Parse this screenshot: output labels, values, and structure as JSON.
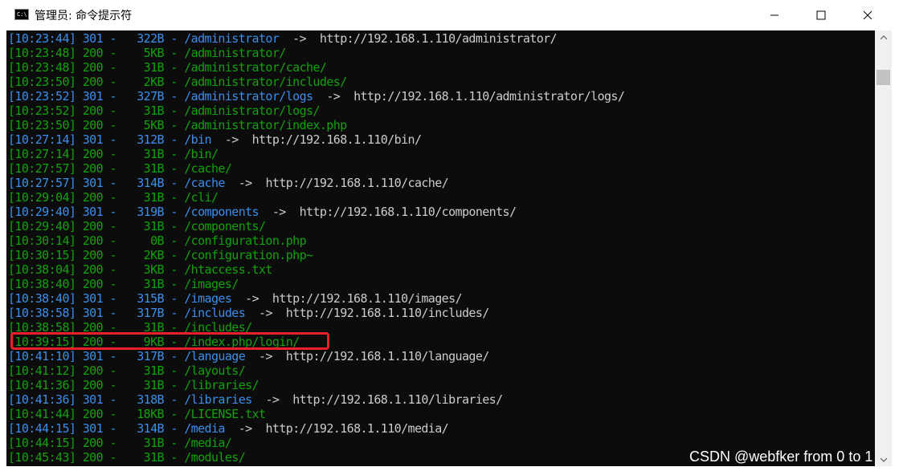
{
  "window": {
    "title": "管理员: 命令提示符",
    "icon_text": "C:\\"
  },
  "console": {
    "lines": [
      {
        "time": "[10:23:44]",
        "status": "301",
        "size": "322B",
        "path": "/administrator",
        "arrow": "->",
        "url": "http://192.168.1.110/administrator/",
        "color": "blue"
      },
      {
        "time": "[10:23:48]",
        "status": "200",
        "size": "5KB",
        "path": "/administrator/",
        "arrow": "",
        "url": "",
        "color": "green"
      },
      {
        "time": "[10:23:48]",
        "status": "200",
        "size": "31B",
        "path": "/administrator/cache/",
        "arrow": "",
        "url": "",
        "color": "green"
      },
      {
        "time": "[10:23:50]",
        "status": "200",
        "size": "2KB",
        "path": "/administrator/includes/",
        "arrow": "",
        "url": "",
        "color": "green"
      },
      {
        "time": "[10:23:52]",
        "status": "301",
        "size": "327B",
        "path": "/administrator/logs",
        "arrow": "->",
        "url": "http://192.168.1.110/administrator/logs/",
        "color": "blue"
      },
      {
        "time": "[10:23:52]",
        "status": "200",
        "size": "31B",
        "path": "/administrator/logs/",
        "arrow": "",
        "url": "",
        "color": "green"
      },
      {
        "time": "[10:23:50]",
        "status": "200",
        "size": "5KB",
        "path": "/administrator/index.php",
        "arrow": "",
        "url": "",
        "color": "green"
      },
      {
        "time": "[10:27:14]",
        "status": "301",
        "size": "312B",
        "path": "/bin",
        "arrow": "->",
        "url": "http://192.168.1.110/bin/",
        "color": "blue"
      },
      {
        "time": "[10:27:14]",
        "status": "200",
        "size": "31B",
        "path": "/bin/",
        "arrow": "",
        "url": "",
        "color": "green"
      },
      {
        "time": "[10:27:57]",
        "status": "200",
        "size": "31B",
        "path": "/cache/",
        "arrow": "",
        "url": "",
        "color": "green"
      },
      {
        "time": "[10:27:57]",
        "status": "301",
        "size": "314B",
        "path": "/cache",
        "arrow": "->",
        "url": "http://192.168.1.110/cache/",
        "color": "blue"
      },
      {
        "time": "[10:29:04]",
        "status": "200",
        "size": "31B",
        "path": "/cli/",
        "arrow": "",
        "url": "",
        "color": "green"
      },
      {
        "time": "[10:29:40]",
        "status": "301",
        "size": "319B",
        "path": "/components",
        "arrow": "->",
        "url": "http://192.168.1.110/components/",
        "color": "blue"
      },
      {
        "time": "[10:29:40]",
        "status": "200",
        "size": "31B",
        "path": "/components/",
        "arrow": "",
        "url": "",
        "color": "green"
      },
      {
        "time": "[10:30:14]",
        "status": "200",
        "size": "0B",
        "path": "/configuration.php",
        "arrow": "",
        "url": "",
        "color": "green"
      },
      {
        "time": "[10:30:15]",
        "status": "200",
        "size": "2KB",
        "path": "/configuration.php~",
        "arrow": "",
        "url": "",
        "color": "green"
      },
      {
        "time": "[10:38:04]",
        "status": "200",
        "size": "3KB",
        "path": "/htaccess.txt",
        "arrow": "",
        "url": "",
        "color": "green"
      },
      {
        "time": "[10:38:40]",
        "status": "200",
        "size": "31B",
        "path": "/images/",
        "arrow": "",
        "url": "",
        "color": "green"
      },
      {
        "time": "[10:38:40]",
        "status": "301",
        "size": "315B",
        "path": "/images",
        "arrow": "->",
        "url": "http://192.168.1.110/images/",
        "color": "blue"
      },
      {
        "time": "[10:38:58]",
        "status": "301",
        "size": "317B",
        "path": "/includes",
        "arrow": "->",
        "url": "http://192.168.1.110/includes/",
        "color": "blue"
      },
      {
        "time": "[10:38:58]",
        "status": "200",
        "size": "31B",
        "path": "/includes/",
        "arrow": "",
        "url": "",
        "color": "green"
      },
      {
        "time": "[10:39:15]",
        "status": "200",
        "size": "9KB",
        "path": "/index.php/login/",
        "arrow": "",
        "url": "",
        "color": "green"
      },
      {
        "time": "[10:41:10]",
        "status": "301",
        "size": "317B",
        "path": "/language",
        "arrow": "->",
        "url": "http://192.168.1.110/language/",
        "color": "blue"
      },
      {
        "time": "[10:41:12]",
        "status": "200",
        "size": "31B",
        "path": "/layouts/",
        "arrow": "",
        "url": "",
        "color": "green"
      },
      {
        "time": "[10:41:36]",
        "status": "200",
        "size": "31B",
        "path": "/libraries/",
        "arrow": "",
        "url": "",
        "color": "green"
      },
      {
        "time": "[10:41:36]",
        "status": "301",
        "size": "318B",
        "path": "/libraries",
        "arrow": "->",
        "url": "http://192.168.1.110/libraries/",
        "color": "blue"
      },
      {
        "time": "[10:41:44]",
        "status": "200",
        "size": "18KB",
        "path": "/LICENSE.txt",
        "arrow": "",
        "url": "",
        "color": "green"
      },
      {
        "time": "[10:44:15]",
        "status": "301",
        "size": "314B",
        "path": "/media",
        "arrow": "->",
        "url": "http://192.168.1.110/media/",
        "color": "blue"
      },
      {
        "time": "[10:44:15]",
        "status": "200",
        "size": "31B",
        "path": "/media/",
        "arrow": "",
        "url": "",
        "color": "green"
      },
      {
        "time": "[10:45:43]",
        "status": "200",
        "size": "31B",
        "path": "/modules/",
        "arrow": "",
        "url": "",
        "color": "green"
      }
    ],
    "highlighted_line_index": 21
  },
  "colors": {
    "console_bg": "#0c0c0c",
    "status_301": "#3b8eea",
    "status_200": "#13a10e",
    "url_text": "#cccccc",
    "highlight": "#e8202a"
  },
  "icons": {
    "minimize": "minimize-icon",
    "maximize": "maximize-icon",
    "close": "close-icon",
    "scroll_up": "chevron-up-icon",
    "scroll_down": "chevron-down-icon"
  },
  "watermark": "CSDN @webfker from 0 to 1"
}
